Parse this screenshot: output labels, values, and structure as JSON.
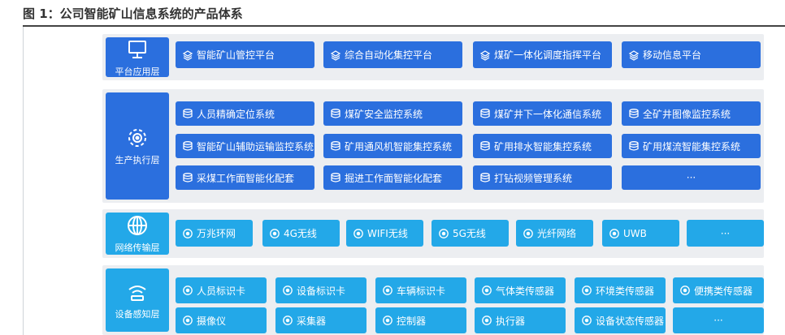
{
  "figure": {
    "title": "图 1：公司智能矿山信息系统的产品体系"
  },
  "colors": {
    "dark_blue": "#2b6fde",
    "light_blue": "#23a8e8",
    "panel": "#eceef1"
  },
  "layers": [
    {
      "label": "平台应用层",
      "icon": "monitor-icon",
      "rows": [
        [
          "智能矿山管控平台",
          "综合自动化集控平台",
          "煤矿一体化调度指挥平台",
          "移动信息平台"
        ]
      ]
    },
    {
      "label": "生产执行层",
      "icon": "gear-settings-icon",
      "rows": [
        [
          "人员精确定位系统",
          "煤矿安全监控系统",
          "煤矿井下一体化通信系统",
          "全矿井图像监控系统"
        ],
        [
          "智能矿山辅助运输监控系统",
          "矿用通风机智能集控系统",
          "矿用排水智能集控系统",
          "矿用煤流智能集控系统"
        ],
        [
          "采煤工作面智能化配套",
          "掘进工作面智能化配套",
          "打钻视频管理系统",
          "···"
        ]
      ]
    },
    {
      "label": "网络传输层",
      "icon": "globe-icon",
      "rows": [
        [
          "万兆环网",
          "4G无线",
          "WIFI无线",
          "5G无线",
          "光纤网络",
          "UWB",
          "···"
        ]
      ]
    },
    {
      "label": "设备感知层",
      "icon": "wifi-sensor-icon",
      "rows": [
        [
          "人员标识卡",
          "设备标识卡",
          "车辆标识卡",
          "气体类传感器",
          "环境类传感器",
          "便携类传感器"
        ],
        [
          "摄像仪",
          "采集器",
          "控制器",
          "执行器",
          "设备状态传感器",
          "···"
        ]
      ]
    }
  ]
}
